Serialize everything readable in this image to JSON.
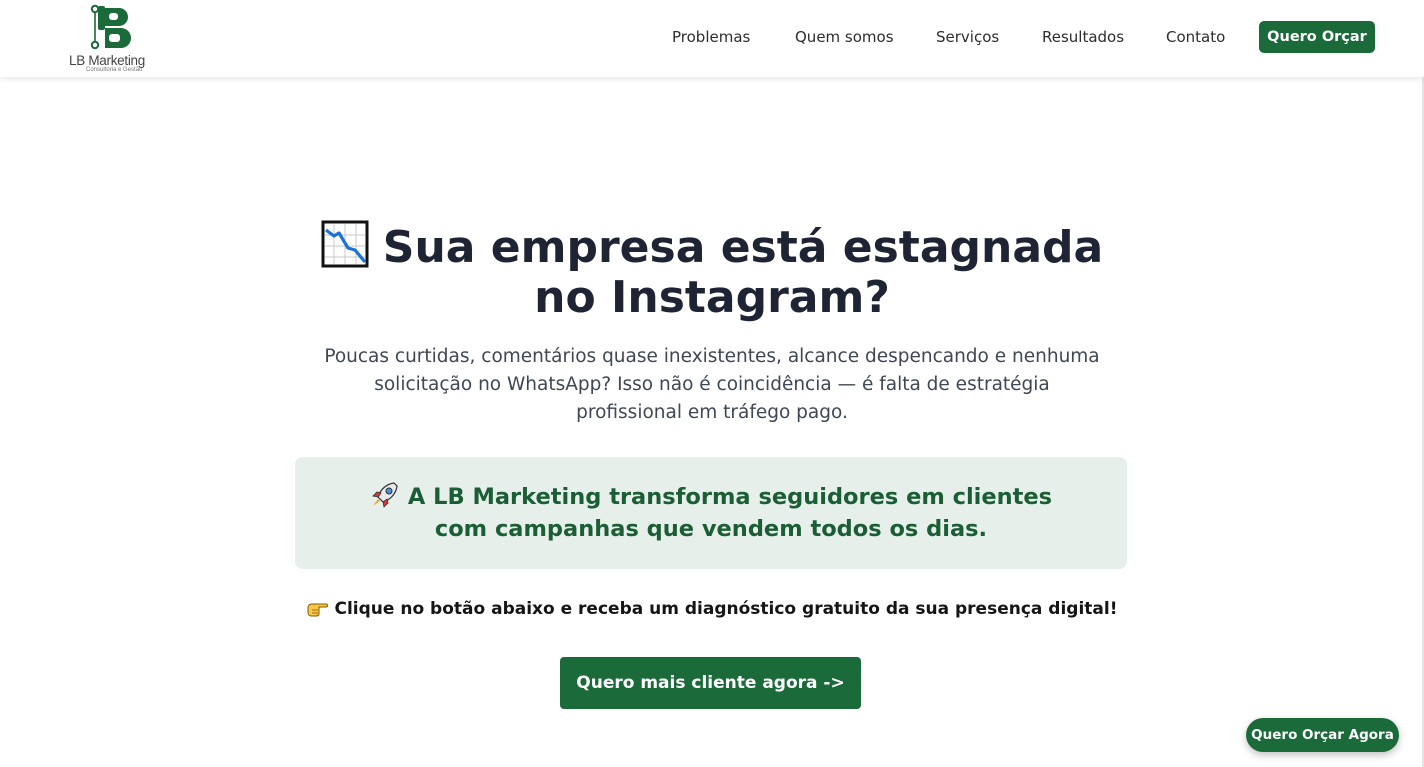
{
  "header": {
    "logo": {
      "name": "LB Marketing",
      "subtitle": "Consultoria e Gestão",
      "icon": "lb-logo-icon"
    },
    "nav": [
      {
        "label": "Problemas"
      },
      {
        "label": "Quem somos"
      },
      {
        "label": "Serviços"
      },
      {
        "label": "Resultados"
      },
      {
        "label": "Contato"
      }
    ],
    "cta_label": "Quero Orçar"
  },
  "hero": {
    "icon": "chart-decreasing-icon",
    "title": "Sua empresa está estagnada no Instagram?",
    "subtitle": "Poucas curtidas, comentários quase inexistentes, alcance despencando e nenhuma solicitação no WhatsApp? Isso não é coincidência — é falta de estratégia profissional em tráfego pago.",
    "highlight_icon": "rocket-icon",
    "highlight": "A LB Marketing transforma seguidores em clientes com campanhas que vendem todos os dias.",
    "cta_icon": "pointing-hand-icon",
    "cta_line": "Clique no botão abaixo e receba um diagnóstico gratuito da sua presença digital!",
    "button_label": "Quero mais cliente agora ->"
  },
  "floating_button": {
    "label": "Quero Orçar Agora"
  },
  "colors": {
    "brand_green": "#1b6b3a",
    "highlight_bg": "#e6efe9",
    "highlight_text": "#1b5e35",
    "title_text": "#1e2433"
  }
}
